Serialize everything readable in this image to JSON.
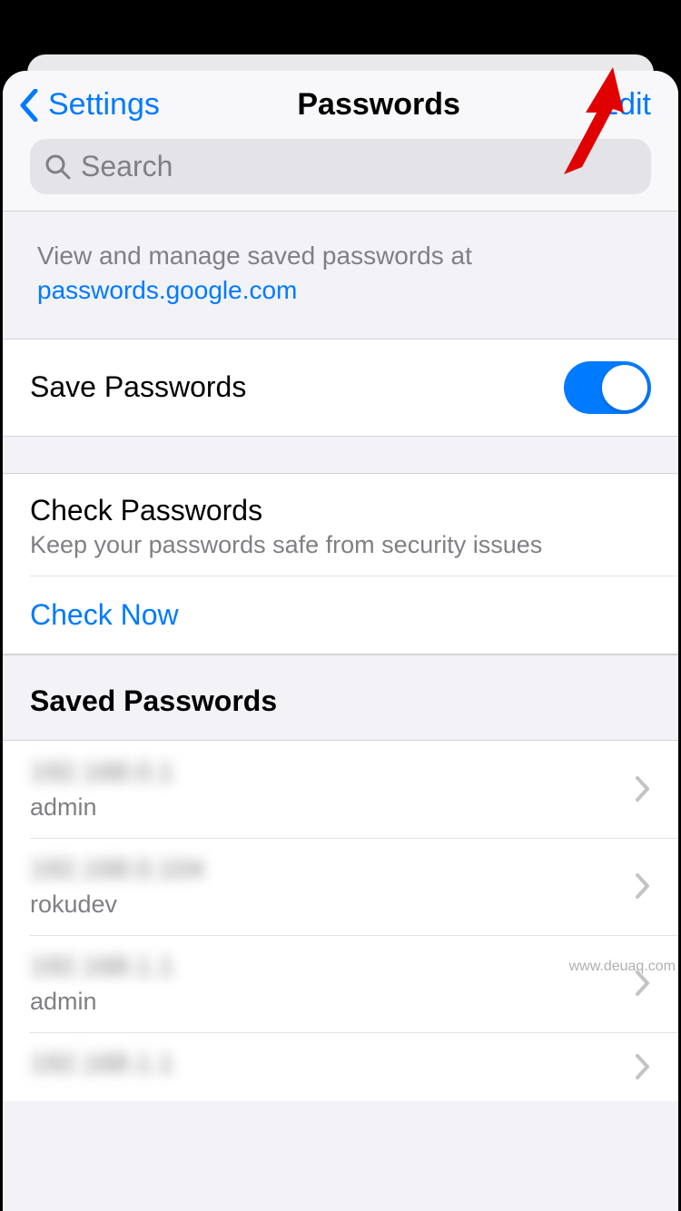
{
  "header": {
    "back_label": "Settings",
    "title": "Passwords",
    "edit_label": "Edit"
  },
  "search": {
    "placeholder": "Search"
  },
  "info": {
    "text": "View and manage saved passwords at ",
    "link": "passwords.google.com"
  },
  "save_passwords": {
    "label": "Save Passwords",
    "enabled": true
  },
  "check": {
    "title": "Check Passwords",
    "subtitle": "Keep your passwords safe from security issues",
    "action": "Check Now"
  },
  "saved_section": {
    "title": "Saved Passwords",
    "items": [
      {
        "site": "192.168.0.1",
        "user": "admin"
      },
      {
        "site": "192.168.0.104",
        "user": "rokudev"
      },
      {
        "site": "192.168.1.1",
        "user": "admin"
      },
      {
        "site": "192.168.1.1",
        "user": ""
      }
    ]
  },
  "watermark": "www.deuaq.com"
}
